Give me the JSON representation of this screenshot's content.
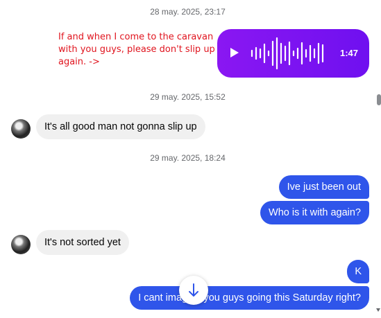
{
  "timestamps": [
    "28 may. 2025, 23:17",
    "29 may. 2025, 15:52",
    "29 may. 2025, 18:24"
  ],
  "annotation": "If and when I come to the caravan with you guys, please don't slip up again. ->",
  "voice_message": {
    "duration": "1:47",
    "icon": "play-icon"
  },
  "messages": [
    {
      "text": "It's all good man not gonna slip up"
    },
    {
      "text": "Ive just been out"
    },
    {
      "text": "Who is it with again?"
    },
    {
      "text": "It's not sorted yet"
    },
    {
      "text": "K"
    },
    {
      "text": "I cant imagine you guys going this Saturday right?"
    }
  ],
  "colors": {
    "outgoing": "#2f55ea",
    "incoming": "#f0f0f0",
    "voice": "#7a14f1",
    "annotation": "#e0141e"
  },
  "icons": {
    "jump": "arrow-down-icon"
  }
}
